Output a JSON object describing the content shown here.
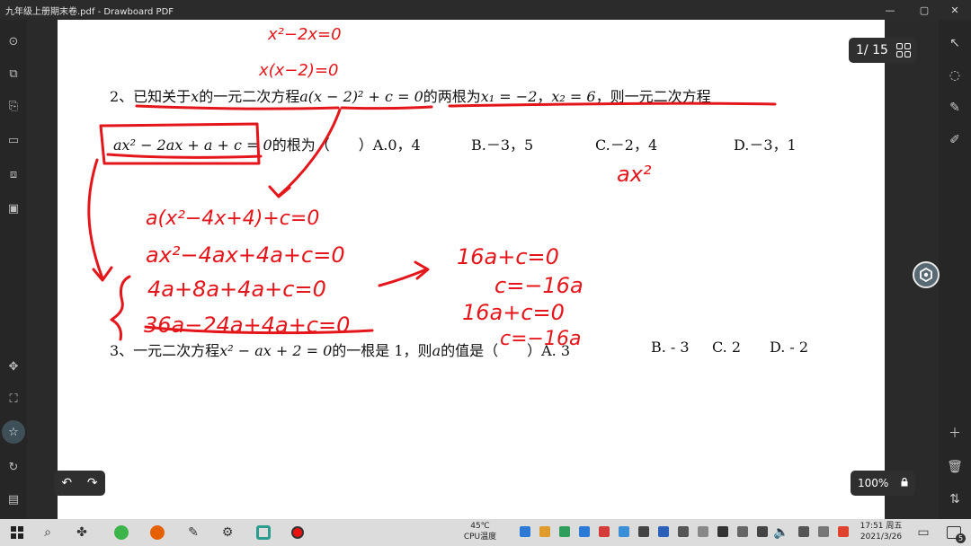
{
  "window": {
    "title": "九年级上册期末卷.pdf - Drawboard PDF",
    "controls": [
      "—",
      "▢",
      "✕"
    ]
  },
  "document": {
    "q2_line1": {
      "part1": "2、已知关于",
      "var_x": "x",
      "part2": "的一元二次方程",
      "eq1": "a(x − 2)² + c = 0",
      "part3": "的两根为",
      "root1": "x₁ = −2",
      "comma": "，",
      "root2": "x₂ = 6",
      "part4": "，则一元二次方程"
    },
    "q2_line2": {
      "eq2": "ax² − 2ax + a + c = 0",
      "part1": "的根为（　　）A.0，4",
      "optB": "B.－3，5",
      "optC": "C.－2，4",
      "optD": "D.－3，1"
    },
    "q3_line": {
      "part1": "3、一元二次方程",
      "eq": "x² − ax + 2 = 0",
      "part2": "的一根是 1，则",
      "var_a": "a",
      "part3": "的值是（　　）A. 3",
      "optB": "B.  - 3",
      "optC": "C. 2",
      "optD": "D.  - 2"
    }
  },
  "handwriting": {
    "top1": "x²−2x=0",
    "top2": "x(x−2)=0",
    "right1": "ax²",
    "w1": "a(x²−4x+4)+c=0",
    "w2": "ax²−4ax+4a+c=0",
    "w3": "4a+8a+4a+c=0",
    "w4": "36a−24a+4a+c=0",
    "r1": "16a+c=0",
    "r2": "c=−16a",
    "r3": "16a+c=0",
    "r4": "c=−16a"
  },
  "viewer": {
    "page_indicator": "1/ 15",
    "zoom": "100%",
    "undo_icon": "undo-icon",
    "redo_icon": "redo-icon"
  },
  "taskbar": {
    "cpu_temp": "45℃",
    "cpu_label": "CPU温度",
    "time": "17:51 周五",
    "date": "2021/3/26",
    "notification_count": "5"
  },
  "colors": {
    "ink": "#e5161b",
    "background": "#1f1f1f",
    "page": "#ffffff"
  }
}
